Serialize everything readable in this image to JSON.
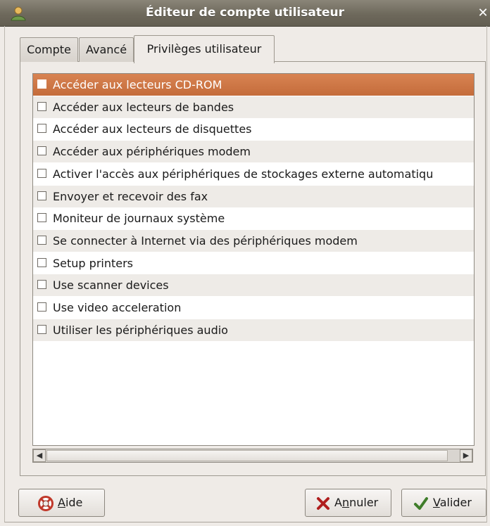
{
  "window": {
    "title": "Éditeur de compte utilisateur",
    "close_glyph": "✕"
  },
  "tabs": [
    {
      "label": "Compte",
      "active": false
    },
    {
      "label": "Avancé",
      "active": false
    },
    {
      "label": "Privilèges utilisateur",
      "active": true
    }
  ],
  "privileges": [
    {
      "label": "Accéder aux lecteurs CD-ROM",
      "checked": false,
      "selected": true
    },
    {
      "label": "Accéder aux lecteurs de bandes",
      "checked": false
    },
    {
      "label": "Accéder aux lecteurs de disquettes",
      "checked": false
    },
    {
      "label": "Accéder aux périphériques modem",
      "checked": false
    },
    {
      "label": "Activer l'accès aux périphériques de stockages externe automatiqu",
      "checked": false
    },
    {
      "label": "Envoyer et recevoir des fax",
      "checked": false
    },
    {
      "label": "Moniteur de journaux système",
      "checked": false
    },
    {
      "label": "Se connecter à Internet via des périphériques modem",
      "checked": false
    },
    {
      "label": "Setup printers",
      "checked": false
    },
    {
      "label": "Use scanner devices",
      "checked": false
    },
    {
      "label": "Use video acceleration",
      "checked": false
    },
    {
      "label": "Utiliser les périphériques audio",
      "checked": false
    }
  ],
  "buttons": {
    "help": {
      "first": "A",
      "rest": "ide"
    },
    "cancel": {
      "first": "A",
      "underline": "n",
      "rest": "nuler"
    },
    "ok": {
      "first": "V",
      "rest": "alider"
    }
  },
  "icons": {
    "app": "user-account-icon",
    "help": "lifebuoy-icon",
    "cancel": "x-icon",
    "ok": "checkmark-icon"
  },
  "colors": {
    "titlebar": "#6e695c",
    "selection": "#c97240",
    "window_bg": "#efebe7"
  }
}
